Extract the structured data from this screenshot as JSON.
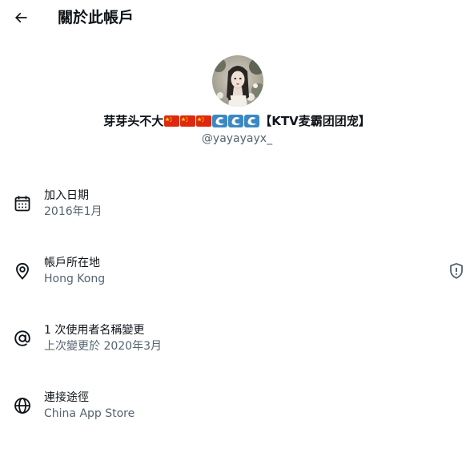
{
  "header": {
    "title": "關於此帳戶"
  },
  "profile": {
    "display_name_text": "芽芽头不大",
    "display_name_suffix": "【KTV麦霸团团宠】",
    "handle": "@yayayayx_",
    "flag_count": 3,
    "wave_count": 3,
    "flag_color": "#de2910",
    "flag_star_color": "#ffde00",
    "wave_color": "#3b88c3"
  },
  "rows": {
    "joined": {
      "label": "加入日期",
      "value": "2016年1月"
    },
    "location": {
      "label": "帳戶所在地",
      "value": "Hong Kong"
    },
    "username_changes": {
      "label": "1 次使用者名稱變更",
      "value": "上次變更於 2020年3月"
    },
    "connected_via": {
      "label": "連接途徑",
      "value": "China App Store"
    }
  },
  "icons": {
    "back": "arrow-left-icon",
    "joined": "calendar-icon",
    "location": "location-pin-icon",
    "location_info": "shield-alert-icon",
    "username_changes": "at-sign-icon",
    "connected_via": "globe-icon"
  },
  "colors": {
    "text_primary": "#0f1419",
    "text_secondary": "#536471",
    "background": "#ffffff"
  }
}
